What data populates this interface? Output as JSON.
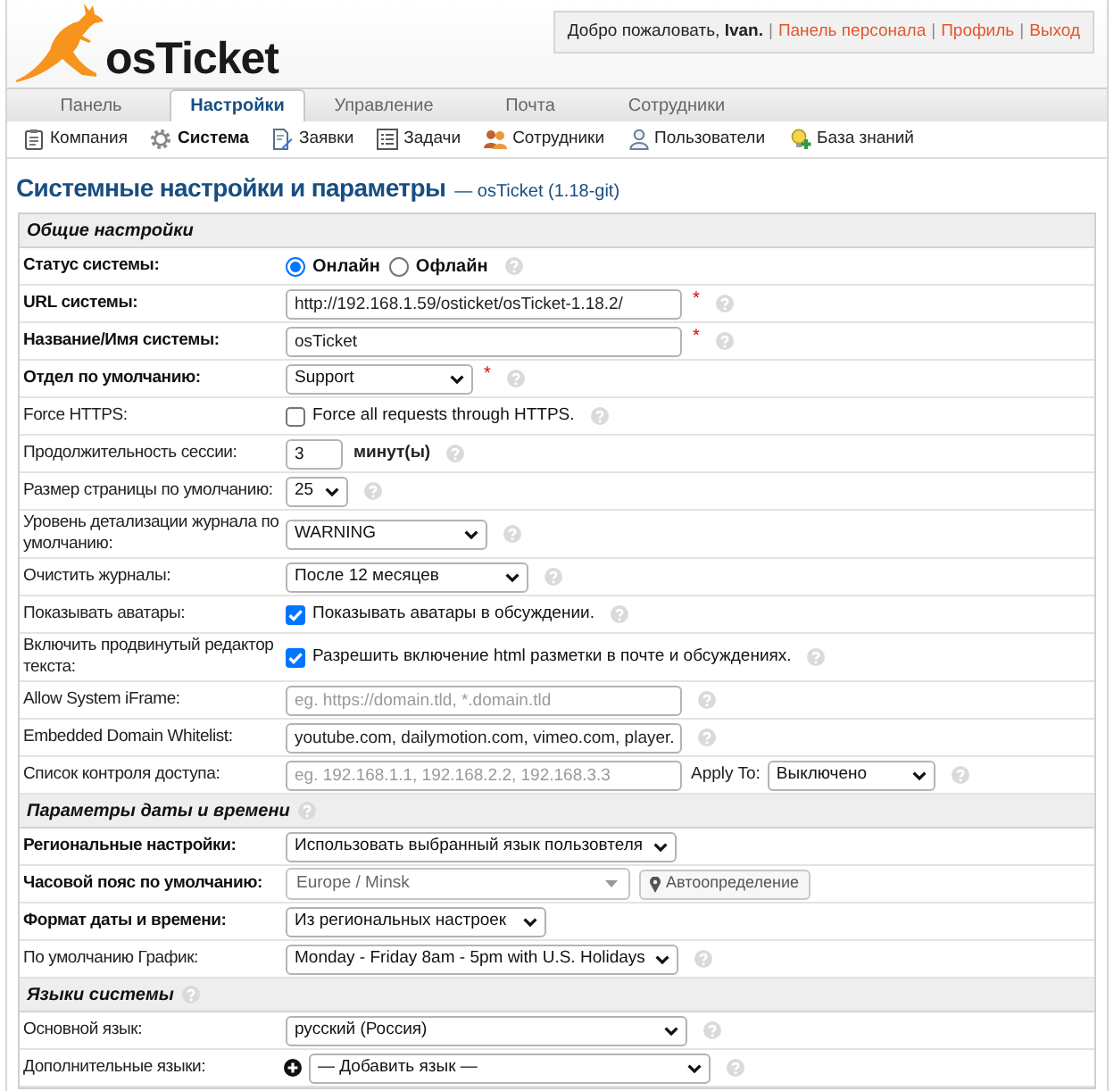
{
  "header": {
    "logo_text": "osTicket",
    "user_bar": {
      "greeting": "Добро пожаловать, **Ivan.**",
      "links": [
        {
          "separator": "|",
          "label": "Панель персонала"
        },
        {
          "separator": "|",
          "label": "Профиль"
        },
        {
          "separator": "|",
          "label": "Выход"
        }
      ]
    }
  },
  "tabs": [
    {
      "label": "Панель",
      "selected": false
    },
    {
      "label": "Настройки",
      "selected": true
    },
    {
      "label": "Управление",
      "selected": false
    },
    {
      "label": "Почта",
      "selected": false
    },
    {
      "label": "Сотрудники",
      "selected": false
    }
  ],
  "subnav": [
    {
      "label": "Компания",
      "selected": false
    },
    {
      "label": "Система",
      "selected": true
    },
    {
      "label": "Заявки",
      "selected": false
    },
    {
      "label": "Задачи",
      "selected": false
    },
    {
      "label": "Сотрудники",
      "selected": false
    },
    {
      "label": "Пользователи",
      "selected": false
    },
    {
      "label": "База знаний",
      "selected": false
    }
  ],
  "page_title": {
    "title": "Системные настройки и параметры",
    "subtitle": "— osTicket (1.18-git)"
  },
  "sections": [
    {
      "title": "Общие настройки",
      "help": false,
      "rows": [
        {
          "label": "Статус системы:",
          "bold": true,
          "kind": "radio",
          "options": [
            {
              "label": "Онлайн",
              "selected": true
            },
            {
              "label": "Офлайн",
              "selected": false
            }
          ],
          "help": true
        },
        {
          "label": "URL системы:",
          "bold": true,
          "kind": "text",
          "value": "http://192.168.1.59/osticket/osTicket-1.18.2/",
          "required_mark": "*",
          "help": true
        },
        {
          "label": "Название/Имя системы:",
          "bold": true,
          "kind": "text",
          "value": "osTicket",
          "required_mark": "*",
          "help": true
        },
        {
          "label": "Отдел по умолчанию:",
          "bold": true,
          "kind": "select",
          "value": "Support",
          "required_mark": "*",
          "help": true
        },
        {
          "label": "Force HTTPS:",
          "bold": false,
          "kind": "checkbox",
          "checked": false,
          "text": "Force all requests through HTTPS.",
          "help": true
        },
        {
          "label": "Продолжительность сессии:",
          "bold": false,
          "kind": "number",
          "value": "3",
          "suffix": "минут(ы)",
          "help": true
        },
        {
          "label": "Размер страницы по умолчанию:",
          "bold": false,
          "kind": "select",
          "value": "25",
          "help": true
        },
        {
          "label": "Уровень детализации журнала по умолчанию:",
          "bold": false,
          "kind": "select",
          "value": "WARNING",
          "help": true
        },
        {
          "label": "Очистить журналы:",
          "bold": false,
          "kind": "select",
          "value": "После 12 месяцев",
          "help": true
        },
        {
          "label": "Показывать аватары:",
          "bold": false,
          "kind": "checkbox",
          "checked": true,
          "text": "Показывать аватары в обсуждении.",
          "help": true
        },
        {
          "label": "Включить продвинутый редактор текста:",
          "bold": false,
          "kind": "checkbox",
          "checked": true,
          "text": "Разрешить включение html разметки в почте и обсуждениях.",
          "help": true
        },
        {
          "label": "Allow System iFrame:",
          "bold": false,
          "kind": "text",
          "placeholder": "eg. https://domain.tld, *.domain.tld",
          "help": true
        },
        {
          "label": "Embedded Domain Whitelist:",
          "bold": false,
          "kind": "text",
          "value": "youtube.com, dailymotion.com, vimeo.com, player.",
          "help": true
        },
        {
          "label": "Список контроля доступа:",
          "bold": false,
          "kind": "text",
          "placeholder": "eg. 192.168.1.1, 192.168.2.2, 192.168.3.3",
          "apply_label": "Apply To:",
          "apply_value": "Выключено",
          "help": true
        }
      ]
    },
    {
      "title": "Параметры даты и времени",
      "help": true,
      "rows": [
        {
          "label": "Региональные настройки:",
          "bold": true,
          "kind": "select",
          "value": "Использовать выбранный язык пользовтеля",
          "help": false
        },
        {
          "label": "Часовой пояс по умолчанию:",
          "bold": true,
          "kind": "timezone",
          "value": "Europe / Minsk",
          "button": "Автоопределение",
          "help": false
        },
        {
          "label": "Формат даты и времени:",
          "bold": true,
          "kind": "select",
          "value": "Из региональных настроек",
          "help": false
        },
        {
          "label": "По умолчанию График:",
          "bold": false,
          "kind": "select",
          "value": "Monday - Friday 8am - 5pm with U.S. Holidays",
          "help": true
        }
      ]
    },
    {
      "title": "Языки системы",
      "help": true,
      "rows": [
        {
          "label": "Основной язык:",
          "bold": false,
          "kind": "select",
          "value": "русский (Россия)",
          "help": true
        },
        {
          "label": "Дополнительные языки:",
          "bold": false,
          "kind": "add_select",
          "value": "— Добавить язык —",
          "help": true
        }
      ]
    }
  ]
}
